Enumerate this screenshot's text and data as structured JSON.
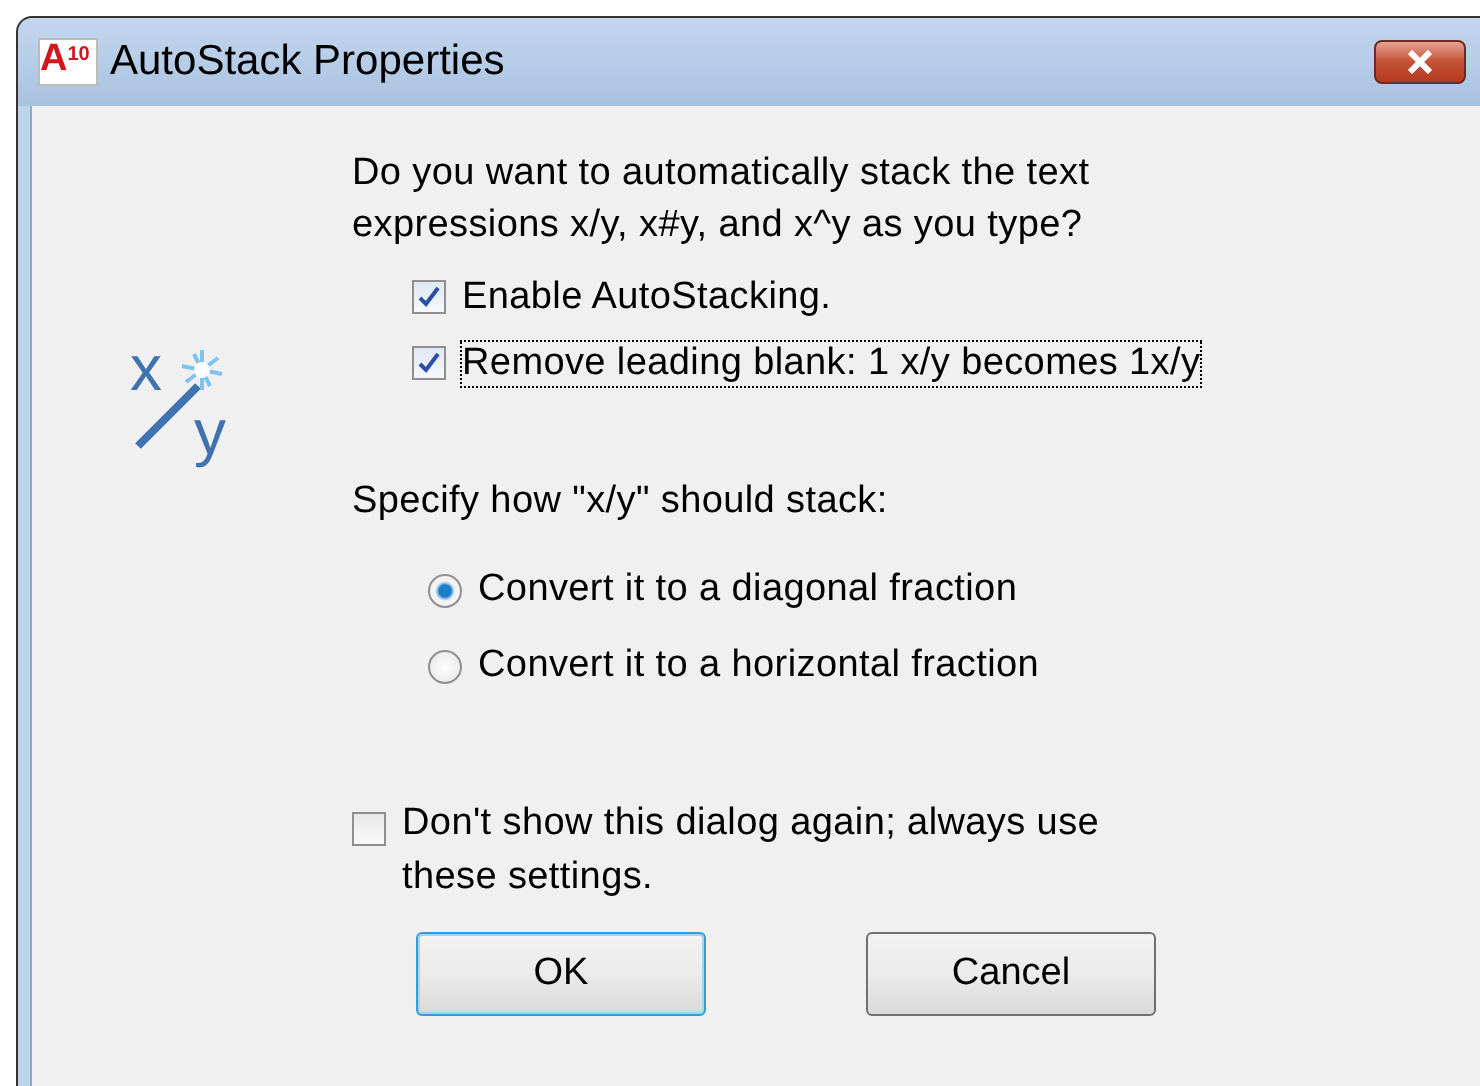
{
  "window": {
    "title": "AutoStack Properties",
    "app_icon": {
      "letter": "A",
      "version": "10"
    }
  },
  "icon": {
    "numerator": "x",
    "denominator": "y"
  },
  "question": "Do you want to automatically stack the text expressions x/y, x#y, and x^y as you type?",
  "options": [
    {
      "label": "Enable AutoStacking.",
      "checked": true,
      "focused": false
    },
    {
      "label": "Remove leading blank:  1 x/y  becomes  1x/y",
      "checked": true,
      "focused": true
    }
  ],
  "stack_prompt": "Specify how \"x/y\" should stack:",
  "stack_modes": [
    {
      "label": "Convert it to a diagonal fraction",
      "selected": true
    },
    {
      "label": "Convert it to a horizontal fraction",
      "selected": false
    }
  ],
  "dont_show": {
    "label": "Don't show this dialog again; always use these settings.",
    "checked": false
  },
  "buttons": [
    {
      "label": "OK",
      "default": true
    },
    {
      "label": "Cancel",
      "default": false
    }
  ]
}
